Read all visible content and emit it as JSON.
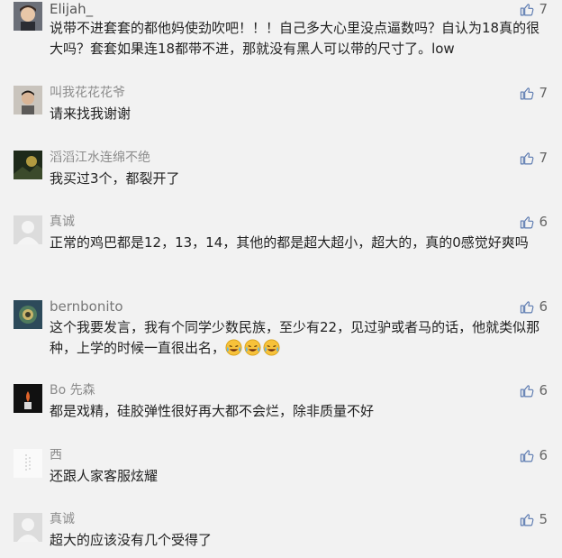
{
  "comments": [
    {
      "name": "Elijah_",
      "avatar": "photo-avatar",
      "likes": "7",
      "text": "说带不进套套的都他妈使劲吹吧！！！自己多大心里没点逼数吗？自认为18真的很大吗？套套如果连18都带不进，那就没有黑人可以带的尺寸了。low"
    },
    {
      "name": "叫我花花花爷",
      "avatar": "photo-avatar",
      "likes": "7",
      "text": "请来找我谢谢"
    },
    {
      "name": "滔滔江水连绵不绝",
      "avatar": "photo-avatar",
      "likes": "7",
      "text": "我买过3个，都裂开了"
    },
    {
      "name": "真诚",
      "avatar": "default-avatar",
      "likes": "6",
      "text": "正常的鸡巴都是12，13，14，其他的都是超大超小，超大的，真的0感觉好爽吗"
    },
    {
      "name": "bernbonito",
      "avatar": "photo-avatar",
      "likes": "6",
      "text": "这个我要发言，我有个同学少数民族，至少有22，见过驴或者马的话，他就类似那种，上学的时候一直很出名，",
      "emojis": [
        "laugh-cry-emoji",
        "laugh-cry-emoji",
        "laugh-cry-emoji"
      ]
    },
    {
      "name": "Bo 先森",
      "avatar": "photo-avatar",
      "likes": "6",
      "text": "都是戏精，硅胶弹性很好再大都不会烂，除非质量不好"
    },
    {
      "name": "西",
      "avatar": "photo-avatar",
      "likes": "6",
      "text": "还跟人家客服炫耀"
    },
    {
      "name": "真诚",
      "avatar": "default-avatar",
      "likes": "5",
      "text": "超大的应该没有几个受得了"
    }
  ],
  "colors": {
    "background": "#f2f2f2",
    "name": "#8c8c8c",
    "text": "#222222",
    "like_icon": "#5b7ab0"
  },
  "icons": {
    "like": "thumbs-up-icon"
  }
}
